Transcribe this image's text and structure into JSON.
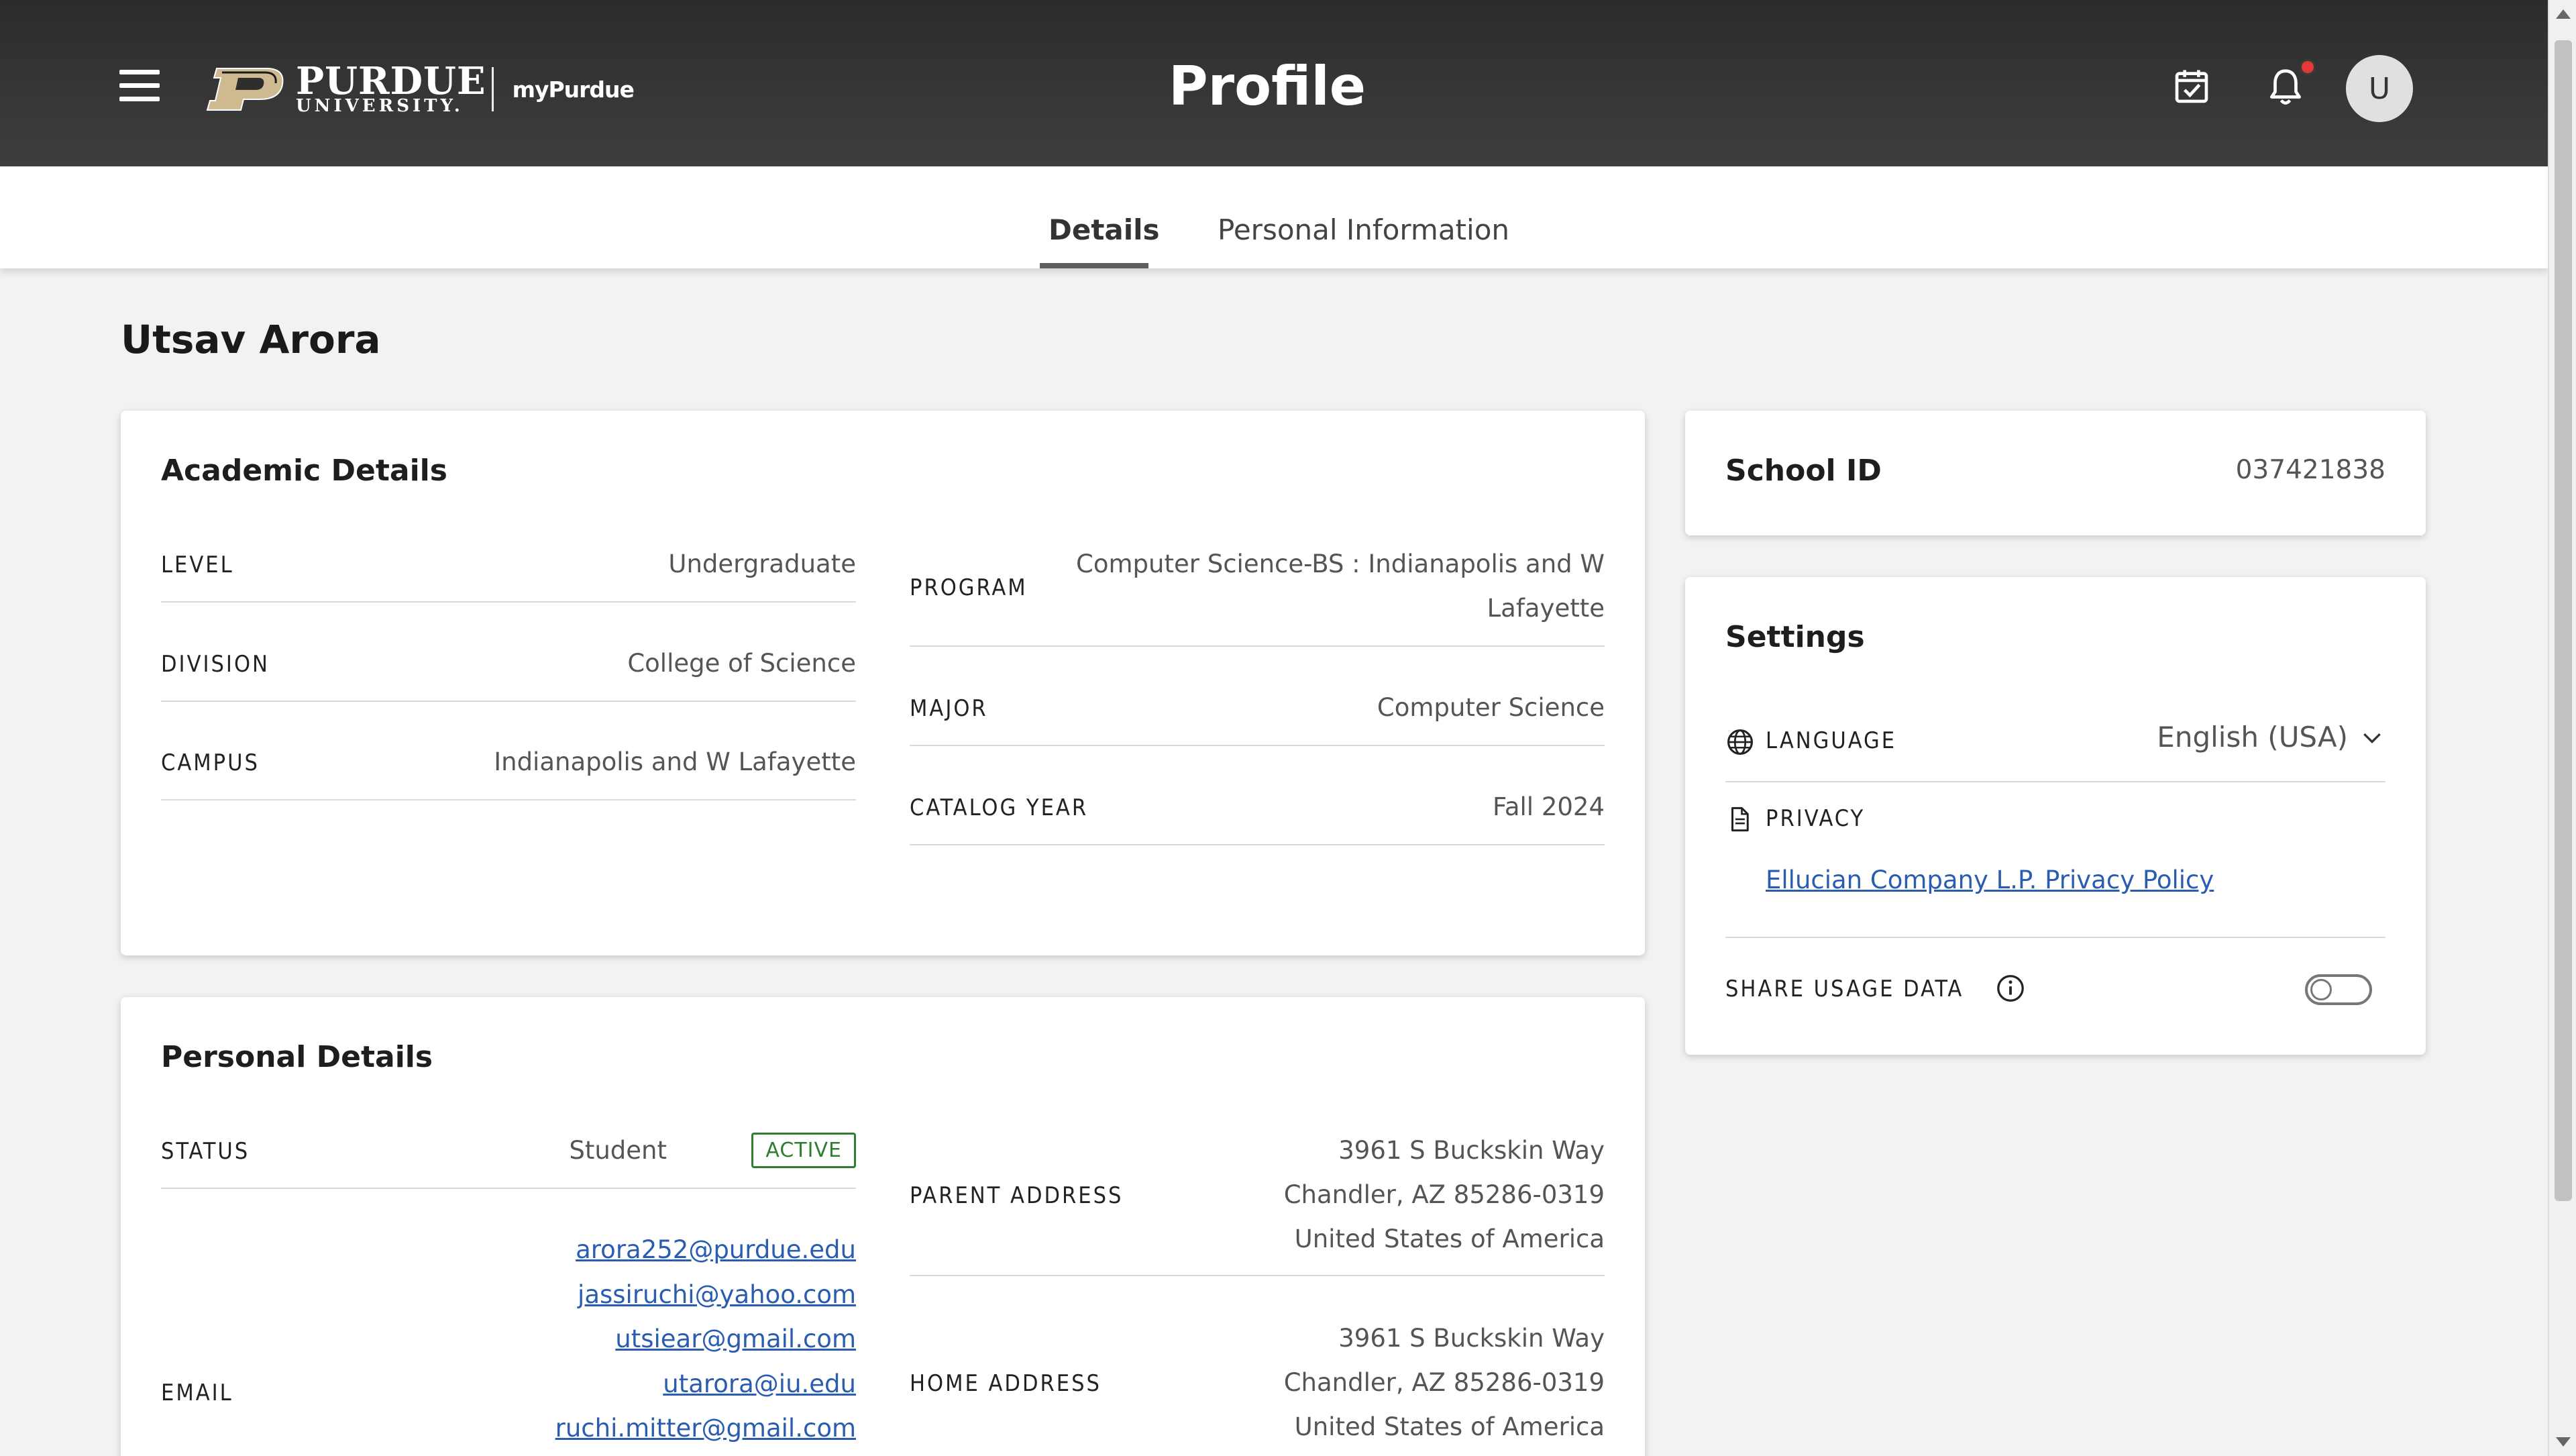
{
  "header": {
    "logo_big": "PURDUE",
    "logo_small": "UNIVERSITY.",
    "app_name": "myPurdue",
    "title": "Profile",
    "avatar_initial": "U",
    "icons": [
      "menu-icon",
      "calendar-check-icon",
      "bell-icon"
    ],
    "notification_dot_color": "#e53935"
  },
  "tabs": [
    {
      "label": "Details",
      "active": true
    },
    {
      "label": "Personal Information",
      "active": false
    }
  ],
  "user": {
    "name": "Utsav Arora"
  },
  "academic": {
    "title": "Academic Details",
    "left": [
      {
        "label": "LEVEL",
        "value": "Undergraduate"
      },
      {
        "label": "DIVISION",
        "value": "College of Science"
      },
      {
        "label": "CAMPUS",
        "value": "Indianapolis and W Lafayette"
      }
    ],
    "right": [
      {
        "label": "PROGRAM",
        "value_line1": "Computer Science-BS : Indianapolis and W",
        "value_line2": "Lafayette"
      },
      {
        "label": "MAJOR",
        "value": "Computer Science"
      },
      {
        "label": "CATALOG YEAR",
        "value": "Fall 2024"
      }
    ]
  },
  "school_id": {
    "label": "School ID",
    "value": "037421838"
  },
  "settings": {
    "title": "Settings",
    "language_label": "LANGUAGE",
    "language_value": "English (USA)",
    "privacy_label": "PRIVACY",
    "privacy_link": "Ellucian Company L.P. Privacy Policy",
    "share_label": "SHARE USAGE DATA",
    "share_enabled": false
  },
  "personal": {
    "title": "Personal Details",
    "status_label": "STATUS",
    "status_value": "Student",
    "status_badge": "ACTIVE",
    "email_label": "EMAIL",
    "emails": [
      "arora252@purdue.edu",
      "jassiruchi@yahoo.com",
      "utsiear@gmail.com",
      "utarora@iu.edu",
      "ruchi.mitter@gmail.com"
    ],
    "parent_address_label": "PARENT ADDRESS",
    "parent_address": [
      "3961 S Buckskin Way",
      "Chandler, AZ 85286-0319",
      "United States of America"
    ],
    "home_address_label": "HOME ADDRESS",
    "home_address": [
      "3961 S Buckskin Way",
      "Chandler, AZ 85286-0319",
      "United States of America"
    ]
  },
  "colors": {
    "header_bg": "#333333",
    "link": "#2a5db0",
    "active_badge": "#2e7d32"
  }
}
